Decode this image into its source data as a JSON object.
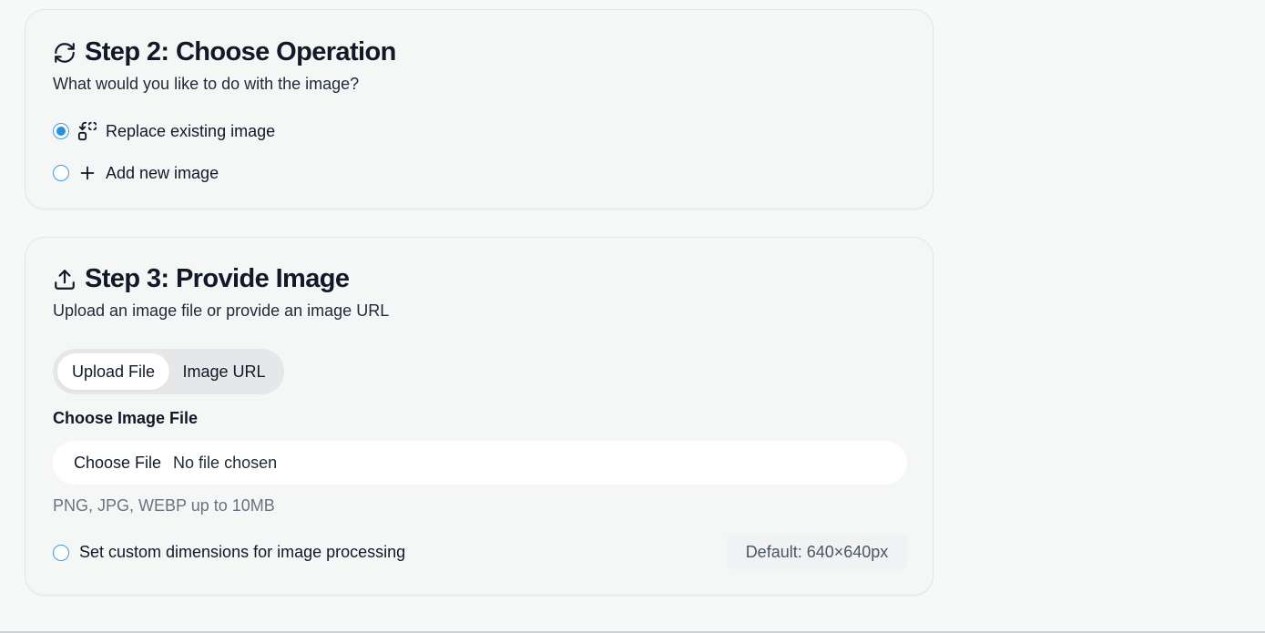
{
  "step2": {
    "title": "Step 2: Choose Operation",
    "title_icon": "refresh-icon",
    "subtitle": "What would you like to do with the image?",
    "options": [
      {
        "label": "Replace existing image",
        "icon": "replace-icon",
        "selected": true
      },
      {
        "label": "Add new image",
        "icon": "plus-icon",
        "selected": false
      }
    ]
  },
  "step3": {
    "title": "Step 3: Provide Image",
    "title_icon": "upload-icon",
    "subtitle": "Upload an image file or provide an image URL",
    "tabs": [
      {
        "label": "Upload File",
        "active": true
      },
      {
        "label": "Image URL",
        "active": false
      }
    ],
    "file_label": "Choose Image File",
    "file_button": "Choose File",
    "file_status": "No file chosen",
    "hint": "PNG, JPG, WEBP up to 10MB",
    "custom_dims_label": "Set custom dimensions for image processing",
    "custom_dims_checked": false,
    "default_dims": "Default: 640×640px"
  },
  "colors": {
    "accent": "#2b8fe0",
    "card_bg": "#f5f6f6",
    "page_bg": "#f7f8f8",
    "muted_text": "#6b7280"
  }
}
